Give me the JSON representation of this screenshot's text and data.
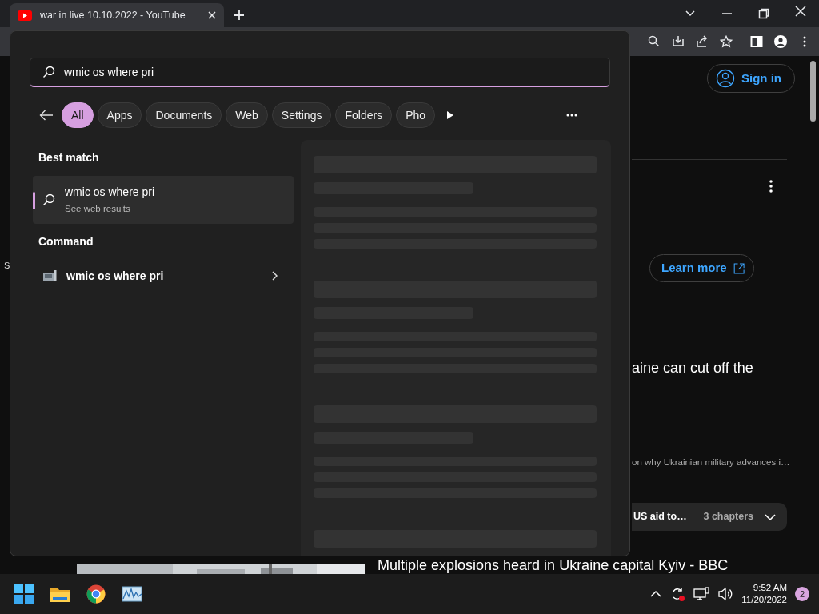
{
  "browser": {
    "tab": {
      "title": "war in live 10.10.2022 - YouTube",
      "selected": true
    }
  },
  "page": {
    "edge_text": "S",
    "sign_in": "Sign in",
    "learn_more": "Learn more",
    "video_title": "aine can cut off the",
    "description": "on why Ukrainian military advances i…",
    "chapter": "US aid to…",
    "chapters_count": "3 chapters",
    "next_video_title": "Multiple explosions heard in Ukraine capital Kyiv - BBC"
  },
  "search": {
    "query": "wmic os where pri",
    "filters": [
      {
        "label": "All",
        "selected": true
      },
      {
        "label": "Apps",
        "selected": false
      },
      {
        "label": "Documents",
        "selected": false
      },
      {
        "label": "Web",
        "selected": false
      },
      {
        "label": "Settings",
        "selected": false
      },
      {
        "label": "Folders",
        "selected": false
      },
      {
        "label": "Pho",
        "selected": false
      }
    ],
    "sections": [
      {
        "heading": "Best match",
        "items": [
          {
            "kind": "web",
            "title": "wmic os where pri",
            "subtitle": "See web results",
            "selected": true
          }
        ]
      },
      {
        "heading": "Command",
        "items": [
          {
            "kind": "command",
            "title": "wmic os where pri",
            "selected": false
          }
        ]
      }
    ]
  },
  "taskbar": {
    "time": "9:52 AM",
    "date": "11/20/2022",
    "notifications": "2"
  }
}
